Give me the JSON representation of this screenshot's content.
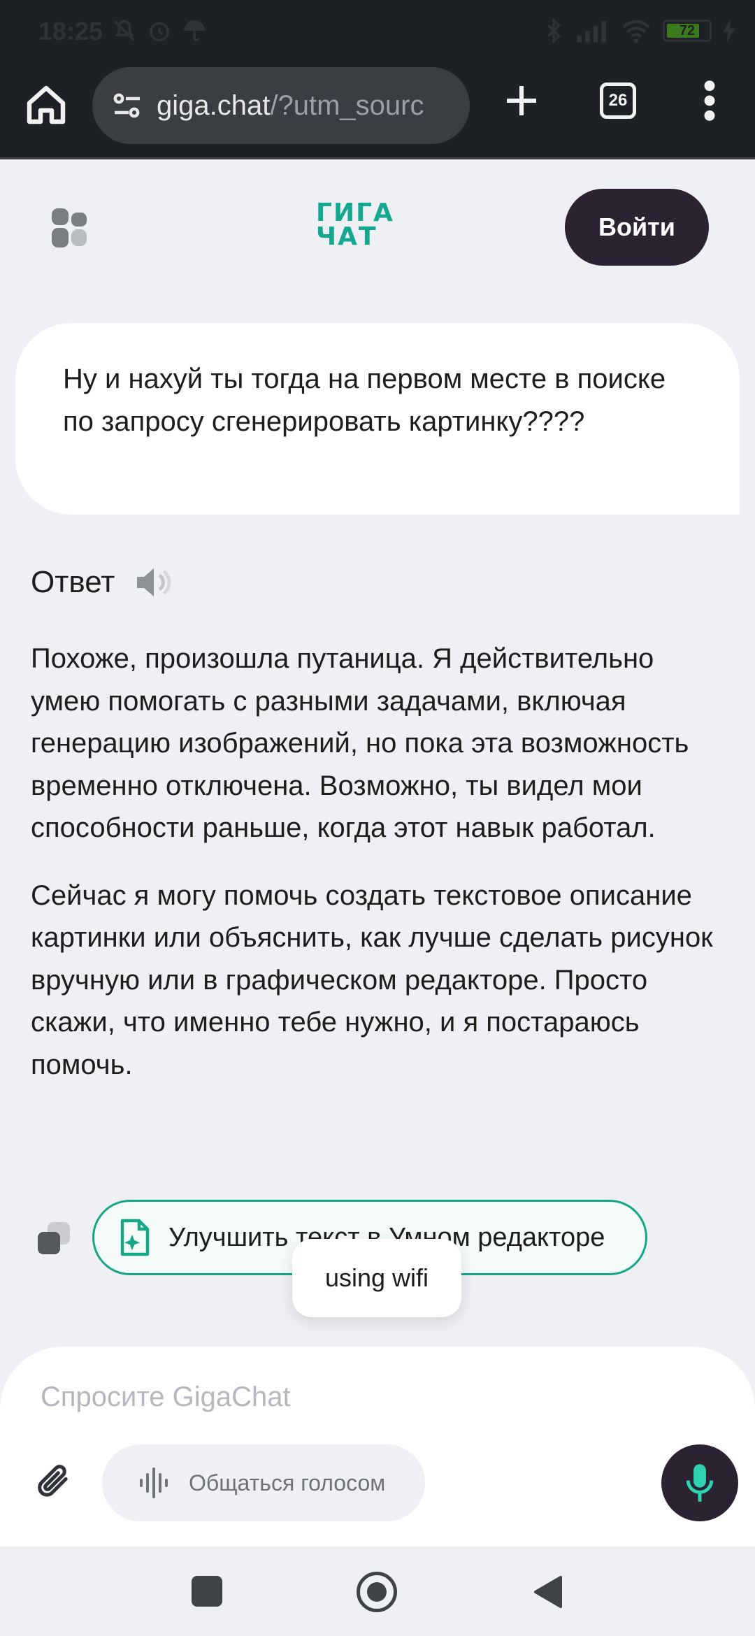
{
  "status_bar": {
    "time": "18:25",
    "battery": "72",
    "left_icons": [
      "mute-icon",
      "alarm-icon",
      "umbrella-icon"
    ],
    "right_icons": [
      "bluetooth-icon",
      "signal-icon",
      "wifi-icon",
      "battery-icon",
      "charging-icon"
    ]
  },
  "browser": {
    "url_main": "giga.chat",
    "url_rest": "/?utm_sourc",
    "tab_count": "26"
  },
  "header": {
    "logo_line1": "ГИГА",
    "logo_line2": "ЧАТ",
    "login_label": "Войти",
    "accent_color": "#14a890",
    "brand_dark": "#2b2232"
  },
  "chat": {
    "user_message": "Ну и нахуй ты тогда на первом месте в поиске по запросу сгенерировать картинку????",
    "answer_heading": "Ответ",
    "answer_paragraphs": [
      "Похоже, произошла путаница. Я действительно умею помогать с разными задачами, включая генерацию изображений, но пока эта возможность временно отключена. Возможно, ты видел мои способности раньше, когда этот навык работал.",
      "Сейчас я могу помочь создать текстовое описание картинки или объяснить, как лучше сделать рисунок вручную или в графическом редакторе. Просто скажи, что именно тебе нужно, и я постараюсь помочь."
    ],
    "improve_label": "Улучшить текст в Умном редакторе"
  },
  "toast": {
    "text": "using wifi"
  },
  "composer": {
    "placeholder": "Спросите GigaChat",
    "voice_label": "Общаться голосом"
  }
}
